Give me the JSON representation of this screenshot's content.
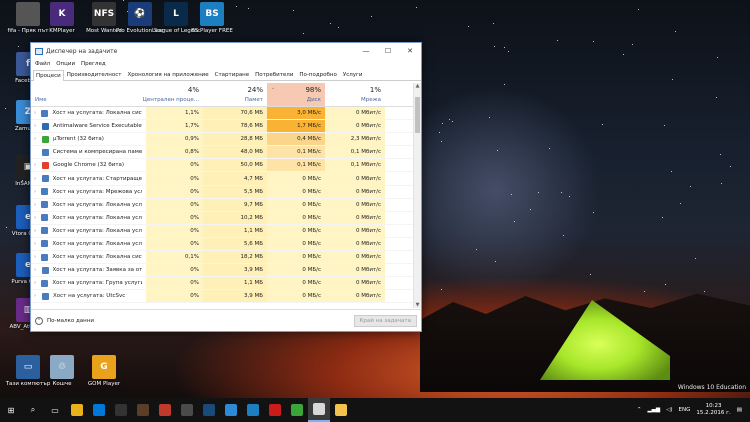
{
  "desktop": {
    "icons": [
      {
        "label": "fifa - Пряк път",
        "glyph": "",
        "color": "#555",
        "col": 0,
        "row": 0
      },
      {
        "label": "KMPlayer",
        "glyph": "K",
        "color": "#4a2a7a",
        "col": 1,
        "row": 0
      },
      {
        "label": "Most Wanted",
        "glyph": "NFS",
        "color": "#333",
        "col": 2,
        "row": 0
      },
      {
        "label": "Pro Evolution Soccer 2016",
        "glyph": "⚽",
        "color": "#1a3d7a",
        "col": 3,
        "row": 0
      },
      {
        "label": "League of Legends",
        "glyph": "L",
        "color": "#0a2a4a",
        "col": 4,
        "row": 0
      },
      {
        "label": "BS.Player FREE",
        "glyph": "BS",
        "color": "#1d7fc1",
        "col": 5,
        "row": 0
      },
      {
        "label": "Facebook",
        "glyph": "f",
        "color": "#3b5998",
        "col": 0,
        "row": 1
      },
      {
        "label": "Zamunda",
        "glyph": "Z",
        "color": "#3a8cd6",
        "col": 0,
        "row": 2
      },
      {
        "label": "InSAMITY",
        "glyph": "▣",
        "color": "#222",
        "col": 0,
        "row": 3
      },
      {
        "label": "Vtora Glava",
        "glyph": "e",
        "color": "#1c5fbd",
        "col": 0,
        "row": 4
      },
      {
        "label": "Purva Glava",
        "glyph": "e",
        "color": "#1c5fbd",
        "col": 0,
        "row": 5
      },
      {
        "label": "ABV_Attach...",
        "glyph": "▥",
        "color": "#6a2a8a",
        "col": 0,
        "row": 6
      },
      {
        "label": "Тази компютър",
        "glyph": "▭",
        "color": "#2c5f9e",
        "col": 0,
        "row": 7
      },
      {
        "label": "Кошче",
        "glyph": "♲",
        "color": "#8aa9c4",
        "col": 1,
        "row": 7
      },
      {
        "label": "GOM Player",
        "glyph": "G",
        "color": "#e8a21b",
        "col": 2,
        "row": 7
      },
      {
        "label": "DAEMON Tools Lite",
        "glyph": "",
        "color": "#333",
        "col": 3,
        "row": 6
      }
    ],
    "watermark_line1": "Windows 10 Education"
  },
  "task_manager": {
    "title": "Диспечер на задачите",
    "controls": {
      "minimize": "—",
      "maximize": "☐",
      "close": "✕"
    },
    "menu": [
      "Файл",
      "Опции",
      "Преглед"
    ],
    "tabs": [
      "Процеси",
      "Производителност",
      "Хронология на приложение",
      "Стартиране",
      "Потребители",
      "По-подробно",
      "Услуги"
    ],
    "active_tab": 0,
    "columns": {
      "name": "Име",
      "cpu": {
        "pct": "4%",
        "label": "Централен проце..."
      },
      "memory": {
        "pct": "24%",
        "label": "Памет"
      },
      "disk": {
        "pct": "98%",
        "label": "Диск"
      },
      "network": {
        "pct": "1%",
        "label": "Мрежа"
      }
    },
    "rows": [
      {
        "name": "Хост на услугата: Локална сист...",
        "cpu": "1,1%",
        "mem": "70,6 МБ",
        "disk": "3,0 МБ/с",
        "net": "0 Мбит/с",
        "expand": true,
        "icon": "#4a7bbf",
        "disk_level": 3
      },
      {
        "name": "Antimalware Service Executable",
        "cpu": "1,7%",
        "mem": "78,6 МБ",
        "disk": "1,7 МБ/с",
        "net": "0 Мбит/с",
        "expand": true,
        "icon": "#2d6bb3",
        "disk_level": 3
      },
      {
        "name": "µTorrent (32 бита)",
        "cpu": "0,9%",
        "mem": "28,8 МБ",
        "disk": "0,4 МБ/с",
        "net": "2,3 Мбит/с",
        "expand": true,
        "icon": "#3aa639",
        "disk_level": 2
      },
      {
        "name": "Система и компресирана памет",
        "cpu": "0,8%",
        "mem": "48,0 МБ",
        "disk": "0,1 МБ/с",
        "net": "0,1 Мбит/с",
        "expand": false,
        "icon": "#4a7bbf",
        "disk_level": 1
      },
      {
        "name": "Google Chrome (32 бита)",
        "cpu": "0%",
        "mem": "50,0 МБ",
        "disk": "0,1 МБ/с",
        "net": "0,1 Мбит/с",
        "expand": true,
        "icon": "#e0402c",
        "disk_level": 1
      },
      {
        "name": "Хост на услугата: Стартираще...",
        "cpu": "0%",
        "mem": "4,7 МБ",
        "disk": "0 МБ/с",
        "net": "0 Мбит/с",
        "expand": true,
        "icon": "#4a7bbf",
        "disk_level": 0
      },
      {
        "name": "Хост на услугата: Мрежова усл...",
        "cpu": "0%",
        "mem": "5,5 МБ",
        "disk": "0 МБ/с",
        "net": "0 Мбит/с",
        "expand": true,
        "icon": "#4a7bbf",
        "disk_level": 0
      },
      {
        "name": "Хост на услугата: Локална услу...",
        "cpu": "0%",
        "mem": "9,7 МБ",
        "disk": "0 МБ/с",
        "net": "0 Мбит/с",
        "expand": true,
        "icon": "#4a7bbf",
        "disk_level": 0
      },
      {
        "name": "Хост на услугата: Локална услу...",
        "cpu": "0%",
        "mem": "10,2 МБ",
        "disk": "0 МБ/с",
        "net": "0 Мбит/с",
        "expand": true,
        "icon": "#4a7bbf",
        "disk_level": 0
      },
      {
        "name": "Хост на услугата: Локална услу...",
        "cpu": "0%",
        "mem": "1,1 МБ",
        "disk": "0 МБ/с",
        "net": "0 Мбит/с",
        "expand": true,
        "icon": "#4a7bbf",
        "disk_level": 0
      },
      {
        "name": "Хост на услугата: Локална услу...",
        "cpu": "0%",
        "mem": "5,6 МБ",
        "disk": "0 МБ/с",
        "net": "0 Мбит/с",
        "expand": true,
        "icon": "#4a7bbf",
        "disk_level": 0
      },
      {
        "name": "Хост на услугата: Локална сист...",
        "cpu": "0,1%",
        "mem": "18,2 МБ",
        "disk": "0 МБ/с",
        "net": "0 Мбит/с",
        "expand": true,
        "icon": "#4a7bbf",
        "disk_level": 0
      },
      {
        "name": "Хост на услугата: Заявка за от...",
        "cpu": "0%",
        "mem": "3,9 МБ",
        "disk": "0 МБ/с",
        "net": "0 Мбит/с",
        "expand": true,
        "icon": "#4a7bbf",
        "disk_level": 0
      },
      {
        "name": "Хост на услугата: Група услуги...",
        "cpu": "0%",
        "mem": "1,1 МБ",
        "disk": "0 МБ/с",
        "net": "0 Мбит/с",
        "expand": true,
        "icon": "#4a7bbf",
        "disk_level": 0
      },
      {
        "name": "Хост на услугата: UtcSvc",
        "cpu": "0%",
        "mem": "3,9 МБ",
        "disk": "0 МБ/с",
        "net": "0 Мбит/с",
        "expand": true,
        "icon": "#4a7bbf",
        "disk_level": 0
      }
    ],
    "footer": {
      "less_details": "По-малко данни",
      "end_task": "Край на задачата"
    },
    "colors": {
      "cpu_bg": "#fff4c4",
      "mem_bg": "#fff0b8",
      "disk_hot": "#f9b233",
      "disk_warm": "#fbd68a",
      "disk_light": "#fde4a6",
      "disk_none": "#fff4c4"
    }
  },
  "taskbar": {
    "items": [
      {
        "name": "start",
        "glyph": "⊞",
        "color": ""
      },
      {
        "name": "search",
        "glyph": "⌕",
        "color": ""
      },
      {
        "name": "task-view",
        "glyph": "▭",
        "color": ""
      },
      {
        "name": "chrome",
        "glyph": "",
        "color": "#e8b21c"
      },
      {
        "name": "explorer",
        "glyph": "",
        "color": "#0078d7"
      },
      {
        "name": "app-dark",
        "glyph": "",
        "color": "#333"
      },
      {
        "name": "app-brown",
        "glyph": "",
        "color": "#5a3e2a"
      },
      {
        "name": "app-red",
        "glyph": "",
        "color": "#c0392b"
      },
      {
        "name": "app-fog",
        "glyph": "",
        "color": "#4a4a4a"
      },
      {
        "name": "league",
        "glyph": "",
        "color": "#1a4a7a"
      },
      {
        "name": "app-blue",
        "glyph": "",
        "color": "#2d8ad6"
      },
      {
        "name": "bsplayer",
        "glyph": "",
        "color": "#1d7fc1"
      },
      {
        "name": "opera",
        "glyph": "",
        "color": "#cc1b1b"
      },
      {
        "name": "utorrent",
        "glyph": "",
        "color": "#3aa639"
      },
      {
        "name": "task-manager",
        "glyph": "",
        "color": "#d8d8d8"
      },
      {
        "name": "folder",
        "glyph": "",
        "color": "#f2c14e"
      }
    ],
    "tray": {
      "lang": "ENG",
      "time": "10:23",
      "date": "15.2.2016 г."
    }
  }
}
